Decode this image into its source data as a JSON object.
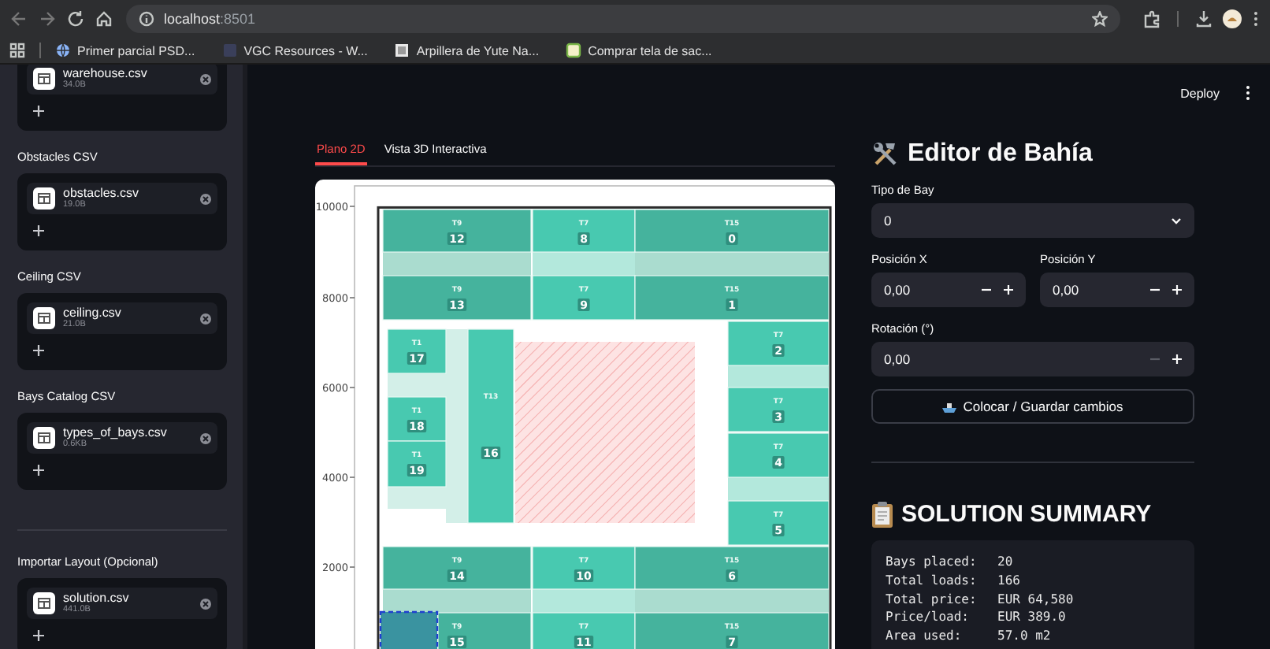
{
  "browser": {
    "host": "localhost",
    "port": ":8501",
    "bookmarks": [
      {
        "label": "Primer parcial PSD...",
        "kind": "globe"
      },
      {
        "label": "VGC Resources - W...",
        "kind": "blank"
      },
      {
        "label": "Arpillera de Yute Na...",
        "kind": "image"
      },
      {
        "label": "Comprar tela de sac...",
        "kind": "green"
      }
    ]
  },
  "sidebar": {
    "uploaders": [
      {
        "file": "warehouse.csv",
        "size": "34.0B"
      },
      {
        "label": "Obstacles CSV",
        "file": "obstacles.csv",
        "size": "19.0B"
      },
      {
        "label": "Ceiling CSV",
        "file": "ceiling.csv",
        "size": "21.0B"
      },
      {
        "label": "Bays Catalog CSV",
        "file": "types_of_bays.csv",
        "size": "0.6KB"
      }
    ],
    "import_layout": {
      "label": "Importar Layout (Opcional)",
      "file": "solution.csv",
      "size": "441.0B"
    }
  },
  "header": {
    "deploy": "Deploy"
  },
  "tabs": [
    {
      "label": "Plano 2D",
      "selected": true
    },
    {
      "label": "Vista 3D Interactiva",
      "selected": false
    }
  ],
  "plot": {
    "y_ticks": [
      "10000",
      "8000",
      "6000",
      "4000",
      "2000"
    ],
    "placement_preview": true,
    "bays": [
      {
        "type": "T9",
        "number": "12",
        "color": "#45b39d"
      },
      {
        "type": "T7",
        "number": "8",
        "color": "#48c9b0"
      },
      {
        "type": "T15",
        "number": "0",
        "color": "#45b39d"
      },
      {
        "type": "T9",
        "number": "13",
        "color": "#45b39d"
      },
      {
        "type": "T7",
        "number": "9",
        "color": "#48c9b0"
      },
      {
        "type": "T15",
        "number": "1",
        "color": "#45b39d"
      },
      {
        "type": "T1",
        "number": "17",
        "color": "#48c9b0"
      },
      {
        "type": "T13",
        "number": "16",
        "color": "#48c9b0"
      },
      {
        "type": "T7",
        "number": "2",
        "color": "#48c9b0"
      },
      {
        "type": "T1",
        "number": "18",
        "color": "#48c9b0"
      },
      {
        "type": "T7",
        "number": "3",
        "color": "#48c9b0"
      },
      {
        "type": "T7",
        "number": "4",
        "color": "#48c9b0"
      },
      {
        "type": "T1",
        "number": "19",
        "color": "#48c9b0"
      },
      {
        "type": "T7",
        "number": "5",
        "color": "#48c9b0"
      },
      {
        "type": "T9",
        "number": "14",
        "color": "#45b39d"
      },
      {
        "type": "T7",
        "number": "10",
        "color": "#48c9b0"
      },
      {
        "type": "T15",
        "number": "6",
        "color": "#45b39d"
      },
      {
        "type": "T9",
        "number": "15",
        "color": "#45b39d"
      },
      {
        "type": "T7",
        "number": "11",
        "color": "#48c9b0"
      },
      {
        "type": "T15",
        "number": "7",
        "color": "#45b39d"
      }
    ]
  },
  "editor": {
    "title": "Editor de Bahía",
    "rows": [
      [
        {
          "label": "Tipo de Bay",
          "kind": "select",
          "value": "0"
        }
      ],
      [
        {
          "label": "Posición X",
          "kind": "number",
          "value": "0,00",
          "decrement_disabled": false
        },
        {
          "label": "Posición Y",
          "kind": "number",
          "value": "0,00",
          "decrement_disabled": false
        }
      ],
      [
        {
          "label": "Rotación (°)",
          "kind": "number",
          "value": "0,00",
          "decrement_disabled": true
        }
      ]
    ],
    "button": "Colocar / Guardar cambios"
  },
  "summary": {
    "title": "SOLUTION SUMMARY",
    "lines": [
      {
        "label": "Bays placed:",
        "value": "20"
      },
      {
        "label": "Total loads:",
        "value": "166"
      },
      {
        "label": "Total price:",
        "value": "EUR 64,580"
      },
      {
        "label": "Price/load:",
        "value": "EUR 389.0"
      },
      {
        "label": "Area used:",
        "value": "57.0 m2"
      }
    ]
  }
}
